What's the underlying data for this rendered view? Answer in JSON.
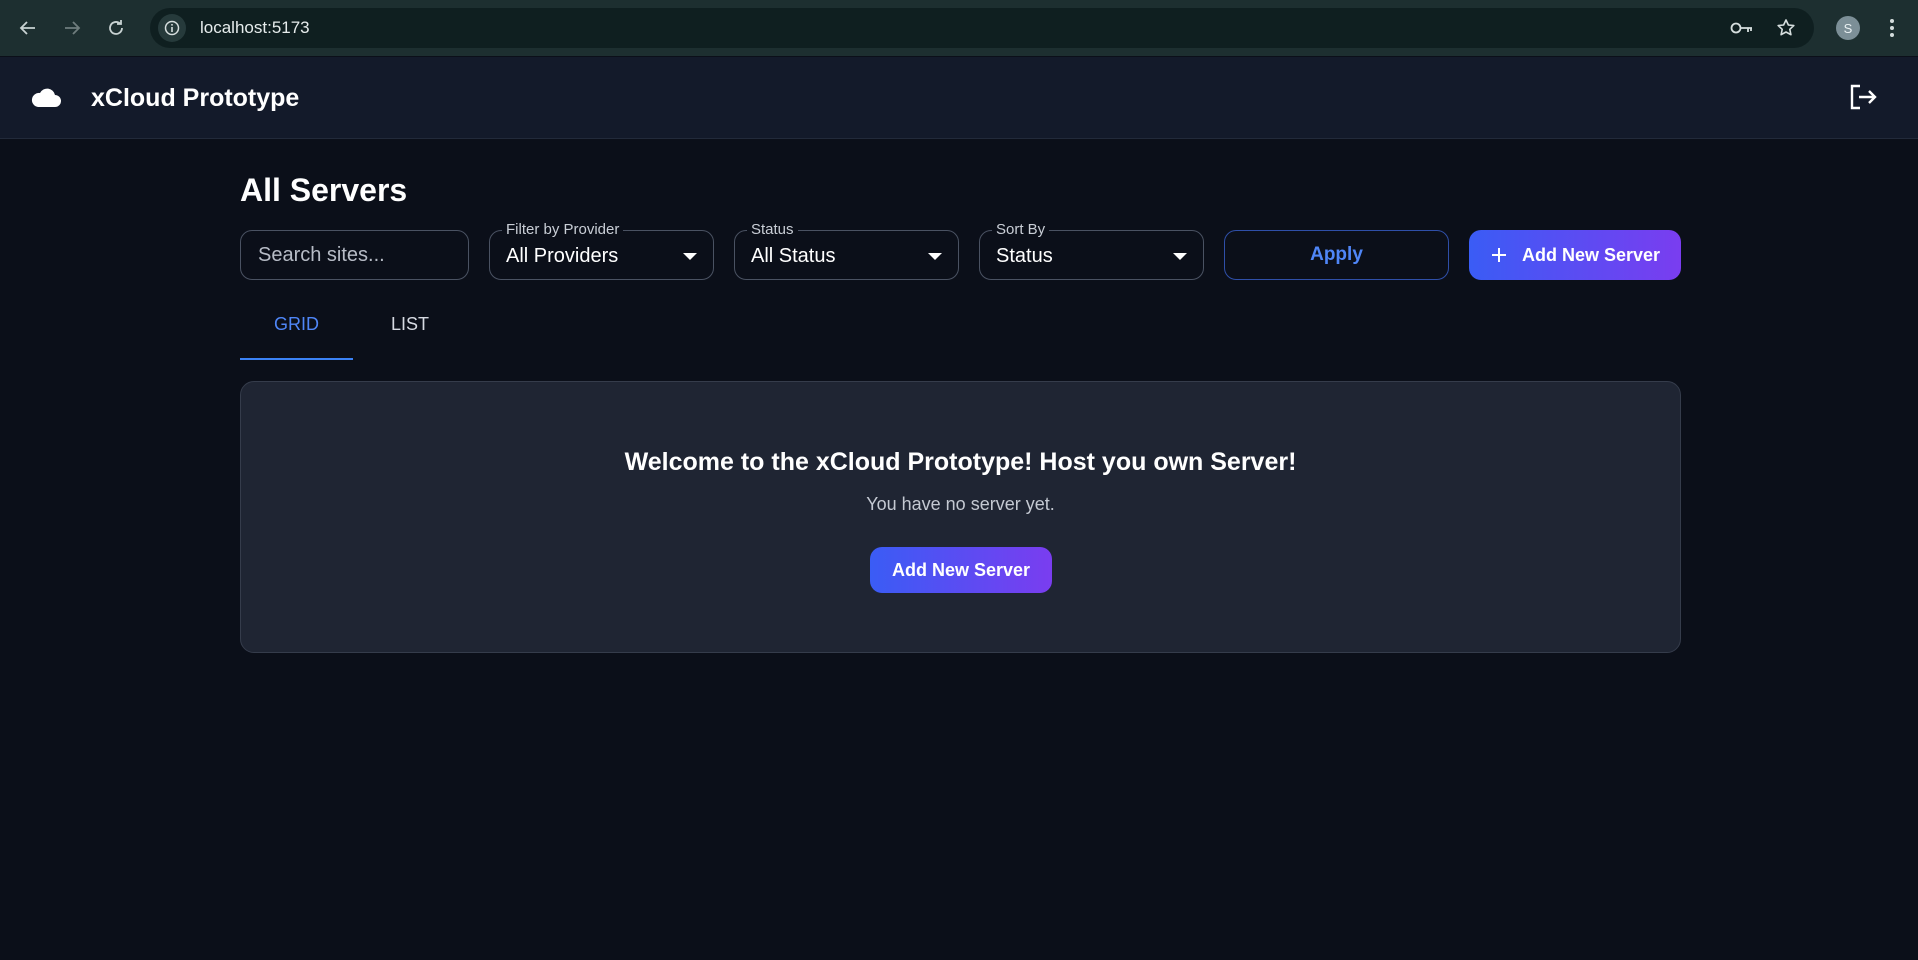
{
  "browser": {
    "url": "localhost:5173",
    "profile_initial": "S",
    "icons": [
      "back-arrow-icon",
      "forward-arrow-icon",
      "reload-icon",
      "site-info-icon",
      "password-key-icon",
      "bookmark-star-icon",
      "menu-kebab-icon"
    ]
  },
  "header": {
    "app_title": "xCloud Prototype",
    "logo_icon": "cloud-icon",
    "logout_icon": "logout-icon"
  },
  "main": {
    "page_title": "All Servers",
    "search": {
      "placeholder": "Search sites..."
    },
    "filters": {
      "provider": {
        "label": "Filter by Provider",
        "value": "All Providers"
      },
      "status": {
        "label": "Status",
        "value": "All Status"
      },
      "sort": {
        "label": "Sort By",
        "value": "Status"
      }
    },
    "apply_label": "Apply",
    "add_server_label": "Add New Server",
    "tabs": [
      {
        "label": "GRID",
        "active": true
      },
      {
        "label": "LIST",
        "active": false
      }
    ],
    "empty_state": {
      "title": "Welcome to the xCloud Prototype! Host you own Server!",
      "subtitle": "You have no server yet.",
      "button_label": "Add New Server"
    }
  },
  "colors": {
    "page_bg": "#0b0f19",
    "header_bg": "#131a2a",
    "card_bg": "#1f2533",
    "accent_blue": "#4f86f7",
    "gradient_start": "#3a5cf5",
    "gradient_end": "#7a3df0"
  }
}
